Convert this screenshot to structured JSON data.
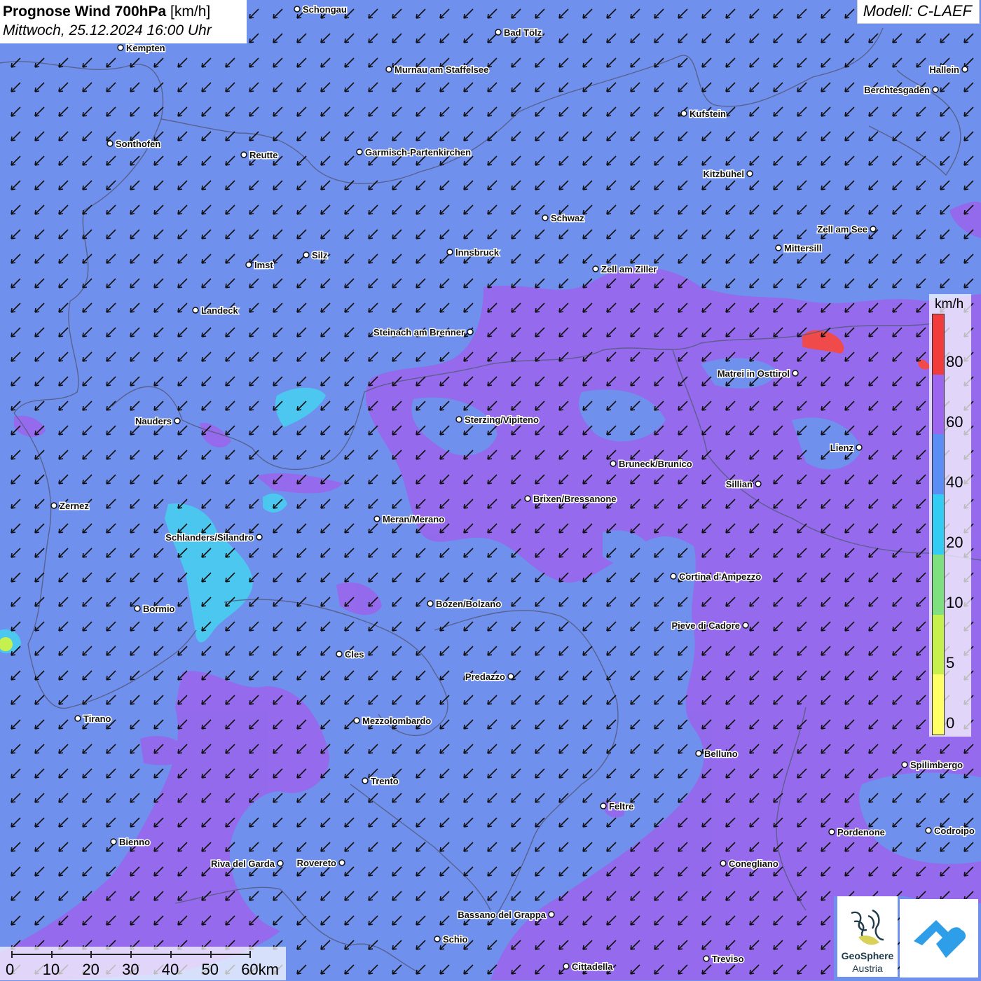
{
  "header": {
    "title_bold": "Prognose Wind 700hPa",
    "title_unit": "[km/h]",
    "datetime": "Mittwoch, 25.12.2024 16:00 Uhr"
  },
  "model_label": "Modell: C-LAEF",
  "legend": {
    "unit": "km/h",
    "ticks": [
      "0",
      "5",
      "10",
      "20",
      "40",
      "60",
      "80"
    ],
    "colors": [
      "#ffff66",
      "#c6f04d",
      "#7fe07f",
      "#33ccf2",
      "#5b8ef5",
      "#9c66ef",
      "#f23c3c"
    ]
  },
  "scale_bar": {
    "labels": [
      "0",
      "10",
      "20",
      "30",
      "40",
      "50",
      "60km"
    ]
  },
  "logos": {
    "geosphere_line1": "GeoSphere",
    "geosphere_line2": "Austria"
  },
  "colors": {
    "base_wind": "#6f90ec",
    "strong_wind": "#9768ec",
    "very_strong": "#f04a4a",
    "moderate": "#48cdf0"
  },
  "wind_direction": "from north-east (arrows point south-west)",
  "cities": [
    {
      "name": "Schongau"
    },
    {
      "name": "Bad Tölz"
    },
    {
      "name": "Kempten"
    },
    {
      "name": "Murnau am Staffelsee"
    },
    {
      "name": "Hallein"
    },
    {
      "name": "Berchtesgaden"
    },
    {
      "name": "Kufstein"
    },
    {
      "name": "Sonthofen"
    },
    {
      "name": "Reutte"
    },
    {
      "name": "Garmisch-Partenkirchen"
    },
    {
      "name": "Kitzbühel"
    },
    {
      "name": "Schwaz"
    },
    {
      "name": "Zell am See"
    },
    {
      "name": "Mittersill"
    },
    {
      "name": "Silz"
    },
    {
      "name": "Innsbruck"
    },
    {
      "name": "Imst"
    },
    {
      "name": "Zell am Ziller"
    },
    {
      "name": "Landeck"
    },
    {
      "name": "Steinach am Brenner"
    },
    {
      "name": "Matrei in Osttirol"
    },
    {
      "name": "Nauders"
    },
    {
      "name": "Sterzing/Vipiteno"
    },
    {
      "name": "Lienz"
    },
    {
      "name": "Bruneck/Brunico"
    },
    {
      "name": "Sillian"
    },
    {
      "name": "Brixen/Bressanone"
    },
    {
      "name": "Zernez"
    },
    {
      "name": "Meran/Merano"
    },
    {
      "name": "Schlanders/Silandro"
    },
    {
      "name": "Cortina d'Ampezzo"
    },
    {
      "name": "Bozen/Bolzano"
    },
    {
      "name": "Bormio"
    },
    {
      "name": "Pieve di Cadore"
    },
    {
      "name": "Cles"
    },
    {
      "name": "Predazzo"
    },
    {
      "name": "Tirano"
    },
    {
      "name": "Mezzolombardo"
    },
    {
      "name": "Belluno"
    },
    {
      "name": "Spilimbergo"
    },
    {
      "name": "Trento"
    },
    {
      "name": "Feltre"
    },
    {
      "name": "Pordenone"
    },
    {
      "name": "Codroipo"
    },
    {
      "name": "Bienno"
    },
    {
      "name": "Riva del Garda"
    },
    {
      "name": "Rovereto"
    },
    {
      "name": "Conegliano"
    },
    {
      "name": "Bassano del Grappa"
    },
    {
      "name": "Schio"
    },
    {
      "name": "Treviso"
    },
    {
      "name": "Cittadella"
    }
  ]
}
